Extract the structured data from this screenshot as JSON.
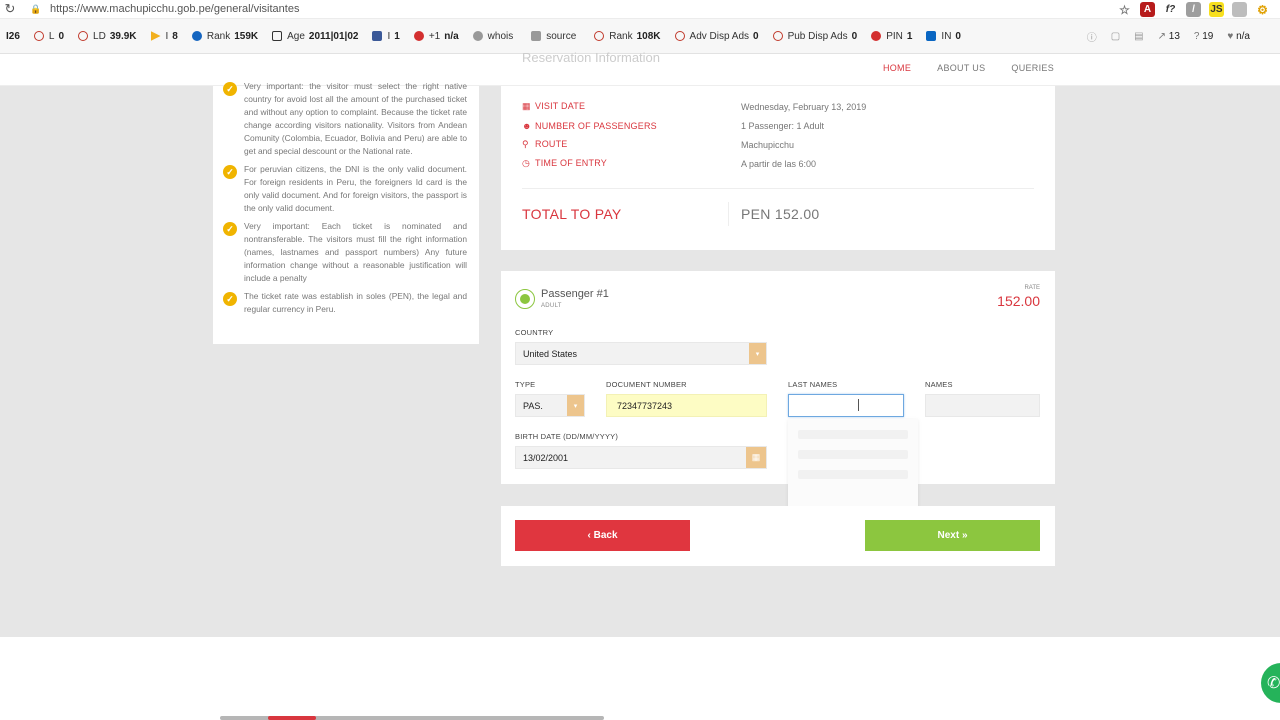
{
  "browser": {
    "url": "https://www.machupicchu.gob.pe/general/visitantes"
  },
  "seo_toolbar": {
    "items": [
      {
        "label": "",
        "value": "I26"
      },
      {
        "label": "L",
        "value": "0"
      },
      {
        "label": "LD",
        "value": "39.9K"
      },
      {
        "label": "I",
        "value": "8"
      },
      {
        "label": "Rank",
        "value": "159K"
      },
      {
        "label": "Age",
        "value": "2011|01|02"
      },
      {
        "label": "I",
        "value": "1"
      },
      {
        "label": "+1",
        "value": "n/a"
      },
      {
        "label": "whois",
        "value": ""
      },
      {
        "label": "source",
        "value": ""
      },
      {
        "label": "Rank",
        "value": "108K"
      },
      {
        "label": "Adv Disp Ads",
        "value": "0"
      },
      {
        "label": "Pub Disp Ads",
        "value": "0"
      },
      {
        "label": "PIN",
        "value": "1"
      },
      {
        "label": "IN",
        "value": "0"
      }
    ],
    "right": {
      "links": "13",
      "count": "19",
      "na": "n/a"
    }
  },
  "nav": {
    "home": "HOME",
    "about": "ABOUT US",
    "queries": "QUERIES"
  },
  "ghost_title": "Reservation Information",
  "info": {
    "items": [
      "Very important: the visitor must select the right native country for avoid lost all the amount of the purchased ticket and without any option to complaint. Because the ticket rate change according visitors nationality. Visitors from Andean Comunity (Colombia, Ecuador, Bolivia and Peru) are able to get and special descount or the National rate.",
      "For peruvian citizens, the DNI is the only valid document. For foreign residents in Peru, the foreigners Id card is the only valid document. And for foreign visitors, the passport is the only valid document.",
      "Very important: Each ticket is nominated and nontransferable. The visitors must fill the right information (names, lastnames and passport numbers) Any future information change without a reasonable justification will include a penalty",
      "The ticket rate was establish in soles (PEN), the legal and regular currency in Peru."
    ]
  },
  "reservation": {
    "rows": [
      {
        "key": "VISIT DATE",
        "value": "Wednesday, February 13, 2019",
        "icon": "calendar-icon"
      },
      {
        "key": "NUMBER OF PASSENGERS",
        "value": "1 Passenger: 1 Adult",
        "icon": "users-icon"
      },
      {
        "key": "ROUTE",
        "value": "Machupicchu",
        "icon": "map-marker-icon"
      },
      {
        "key": "TIME OF ENTRY",
        "value": "A partir de las 6:00",
        "icon": "clock-icon"
      }
    ],
    "total_label": "TOTAL TO PAY",
    "total_value": "PEN 152.00"
  },
  "passenger": {
    "title": "Passenger #1",
    "subtitle": "ADULT",
    "rate_label": "RATE",
    "rate_value": "152.00",
    "country_label": "COUNTRY",
    "country_value": "United States",
    "type_label": "TYPE",
    "type_value": "PAS.",
    "doc_label": "DOCUMENT NUMBER",
    "doc_value": "72347737243",
    "last_names_label": "LAST NAMES",
    "last_names_value": "",
    "names_label": "NAMES",
    "names_value": "",
    "birth_label": "BIRTH DATE (DD/MM/YYYY)",
    "birth_value": "13/02/2001"
  },
  "buttons": {
    "back": "‹ Back",
    "next": "Next »"
  },
  "colors": {
    "accent_red": "#d9363e",
    "accent_green": "#8cc63f",
    "select_tan": "#edc58d",
    "doc_yellow": "#fdfcc4"
  }
}
